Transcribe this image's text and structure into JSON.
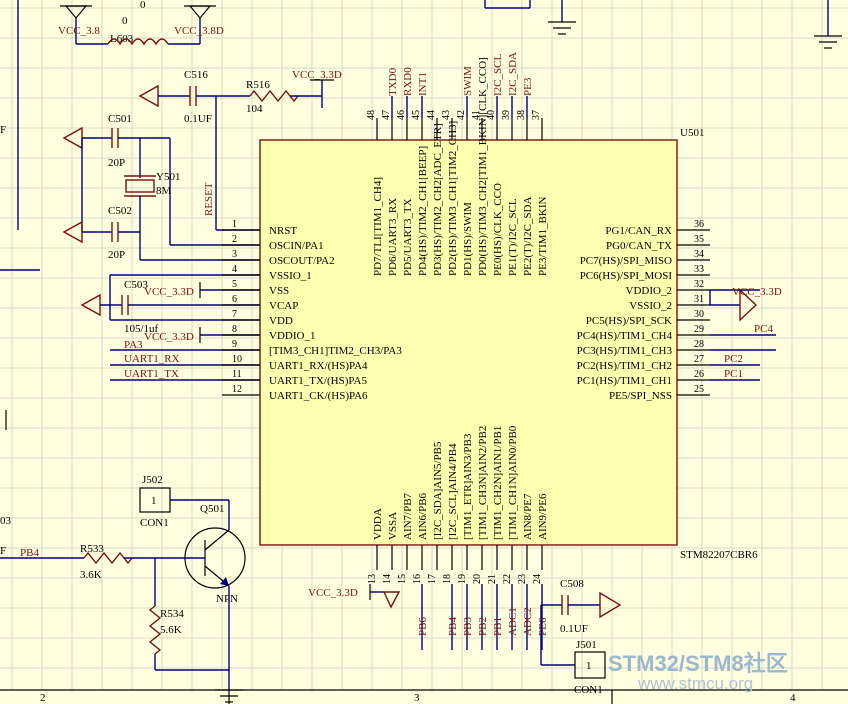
{
  "ic": {
    "ref": "U501",
    "part": "STM82207CBR6",
    "left_pins": [
      {
        "num": "1",
        "name": "NRST"
      },
      {
        "num": "2",
        "name": "OSCIN/PA1"
      },
      {
        "num": "3",
        "name": "OSCOUT/PA2"
      },
      {
        "num": "4",
        "name": "VSSIO_1"
      },
      {
        "num": "5",
        "name": "VSS"
      },
      {
        "num": "6",
        "name": "VCAP"
      },
      {
        "num": "7",
        "name": "VDD"
      },
      {
        "num": "8",
        "name": "VDDIO_1"
      },
      {
        "num": "9",
        "name": "[TIM3_CH1]TIM2_CH3/PA3"
      },
      {
        "num": "10",
        "name": "UART1_RX/(HS)PA4"
      },
      {
        "num": "11",
        "name": "UART1_TX/(HS)PA5"
      },
      {
        "num": "12",
        "name": "UART1_CK/(HS)PA6"
      }
    ],
    "right_pins": [
      {
        "num": "36",
        "name": "PG1/CAN_RX"
      },
      {
        "num": "35",
        "name": "PG0/CAN_TX"
      },
      {
        "num": "34",
        "name": "PC7(HS)/SPI_MISO"
      },
      {
        "num": "33",
        "name": "PC6(HS)/SPI_MOSI"
      },
      {
        "num": "32",
        "name": "VDDIO_2"
      },
      {
        "num": "31",
        "name": "VSSIO_2"
      },
      {
        "num": "30",
        "name": "PC5(HS)/SPI_SCK"
      },
      {
        "num": "29",
        "name": "PC4(HS)/TIM1_CH4"
      },
      {
        "num": "28",
        "name": "PC3(HS)/TIM1_CH3"
      },
      {
        "num": "27",
        "name": "PC2(HS)/TIM1_CH2"
      },
      {
        "num": "26",
        "name": "PC1(HS)/TIM1_CH1"
      },
      {
        "num": "25",
        "name": "PE5/SPI_NSS"
      }
    ],
    "top_pins": [
      {
        "num": "48",
        "name": "PD7/TLI[TIM1_CH4]"
      },
      {
        "num": "47",
        "name": "PD6/UART3_RX"
      },
      {
        "num": "46",
        "name": "PD5/UART3_TX"
      },
      {
        "num": "45",
        "name": "PD4(HS)/TIM2_CH1[BEEP]"
      },
      {
        "num": "44",
        "name": "PD3(HS)/TIM2_CH2[ADC_ETR]"
      },
      {
        "num": "43",
        "name": "PD2(HS)/TIM3_CH1[TIM2_CH3]"
      },
      {
        "num": "42",
        "name": "PD1(HS)/SWIM"
      },
      {
        "num": "41",
        "name": "PD0(HS)/TIM3_CH2[TIM1_BKIN][CLK_CCO]"
      },
      {
        "num": "40",
        "name": "PE0(HS)/CLK_CCO"
      },
      {
        "num": "39",
        "name": "PE1(T)/I2C_SCL"
      },
      {
        "num": "38",
        "name": "PE2(T)/I2C_SDA"
      },
      {
        "num": "37",
        "name": "PE3/TIM1_BKIN"
      }
    ],
    "bottom_pins": [
      {
        "num": "13",
        "name": "VDDA"
      },
      {
        "num": "14",
        "name": "VSSA"
      },
      {
        "num": "15",
        "name": "AIN7/PB7"
      },
      {
        "num": "16",
        "name": "AIN6/PB6"
      },
      {
        "num": "17",
        "name": "[I2C_SDA]AIN5/PB5"
      },
      {
        "num": "18",
        "name": "[I2C_SCL]AIN4/PB4"
      },
      {
        "num": "19",
        "name": "[TIM1_ETR]AIN3/PB3"
      },
      {
        "num": "20",
        "name": "[TIM1_CH3N]AIN2/PB2"
      },
      {
        "num": "21",
        "name": "[TIM1_CH2N]AIN1/PB1"
      },
      {
        "num": "22",
        "name": "[TIM1_CH1N]AIN0/PB0"
      },
      {
        "num": "23",
        "name": "AIN8/PE7"
      },
      {
        "num": "24",
        "name": "AIN9/PE6"
      }
    ]
  },
  "top_nets": [
    "TXD0",
    "RXD0",
    "INT1",
    "",
    "",
    "SWIM",
    "",
    "I2C_SCL",
    "I2C_SDA",
    "PE3"
  ],
  "bottom_nets": [
    "PB6",
    "",
    "PB4",
    "PB3",
    "PB2",
    "PB1",
    "ADC1",
    "ADC2",
    "PE6"
  ],
  "labels": {
    "c_vcc38": "VCC_3.8",
    "zero_a": "0",
    "zero_b": "0",
    "c_vcc38d": "VCC_3.8D",
    "l603": "L603",
    "c516": "C516",
    "c516_val": "0.1UF",
    "r516": "R516",
    "r516_val": "104",
    "vcc33d_top": "VCC_3.3D",
    "c501": "C501",
    "c501_val": "20P",
    "y501": "Y501",
    "y501_val": "8M",
    "c502": "C502",
    "c502_val": "20P",
    "reset": "RESET",
    "c503": "C503",
    "c503_val": "105/1uf",
    "vcc33d_l1": "VCC_3.3D",
    "vcc33d_l2": "VCC_3.3D",
    "pa3": "PA3",
    "uart_rx": "UART1_RX",
    "uart_tx": "UART1_TX",
    "vcc33d_r": "VCC_3.3D",
    "pc4": "PC4",
    "pc2": "PC2",
    "pc1": "PC1",
    "j502": "J502",
    "j502_pin": "1",
    "j502_val": "CON1",
    "q501": "Q501",
    "npn": "NPN",
    "pb4": "PB4",
    "r533": "R533",
    "r533_val": "3.6K",
    "r534": "R534",
    "r534_val": "5.6K",
    "vcc33d_b": "VCC_3.3D",
    "c508": "C508",
    "c508_val": "0.1UF",
    "j501": "J501",
    "j501_pin": "1",
    "j501_val": "CON1",
    "zone2": "2",
    "zone3": "3",
    "zone4": "4",
    "left03": "03",
    "leftF1": "F",
    "leftF2": "F"
  },
  "watermark": {
    "title": "STM32/STM8社区",
    "url": "www.stmcu.org"
  }
}
